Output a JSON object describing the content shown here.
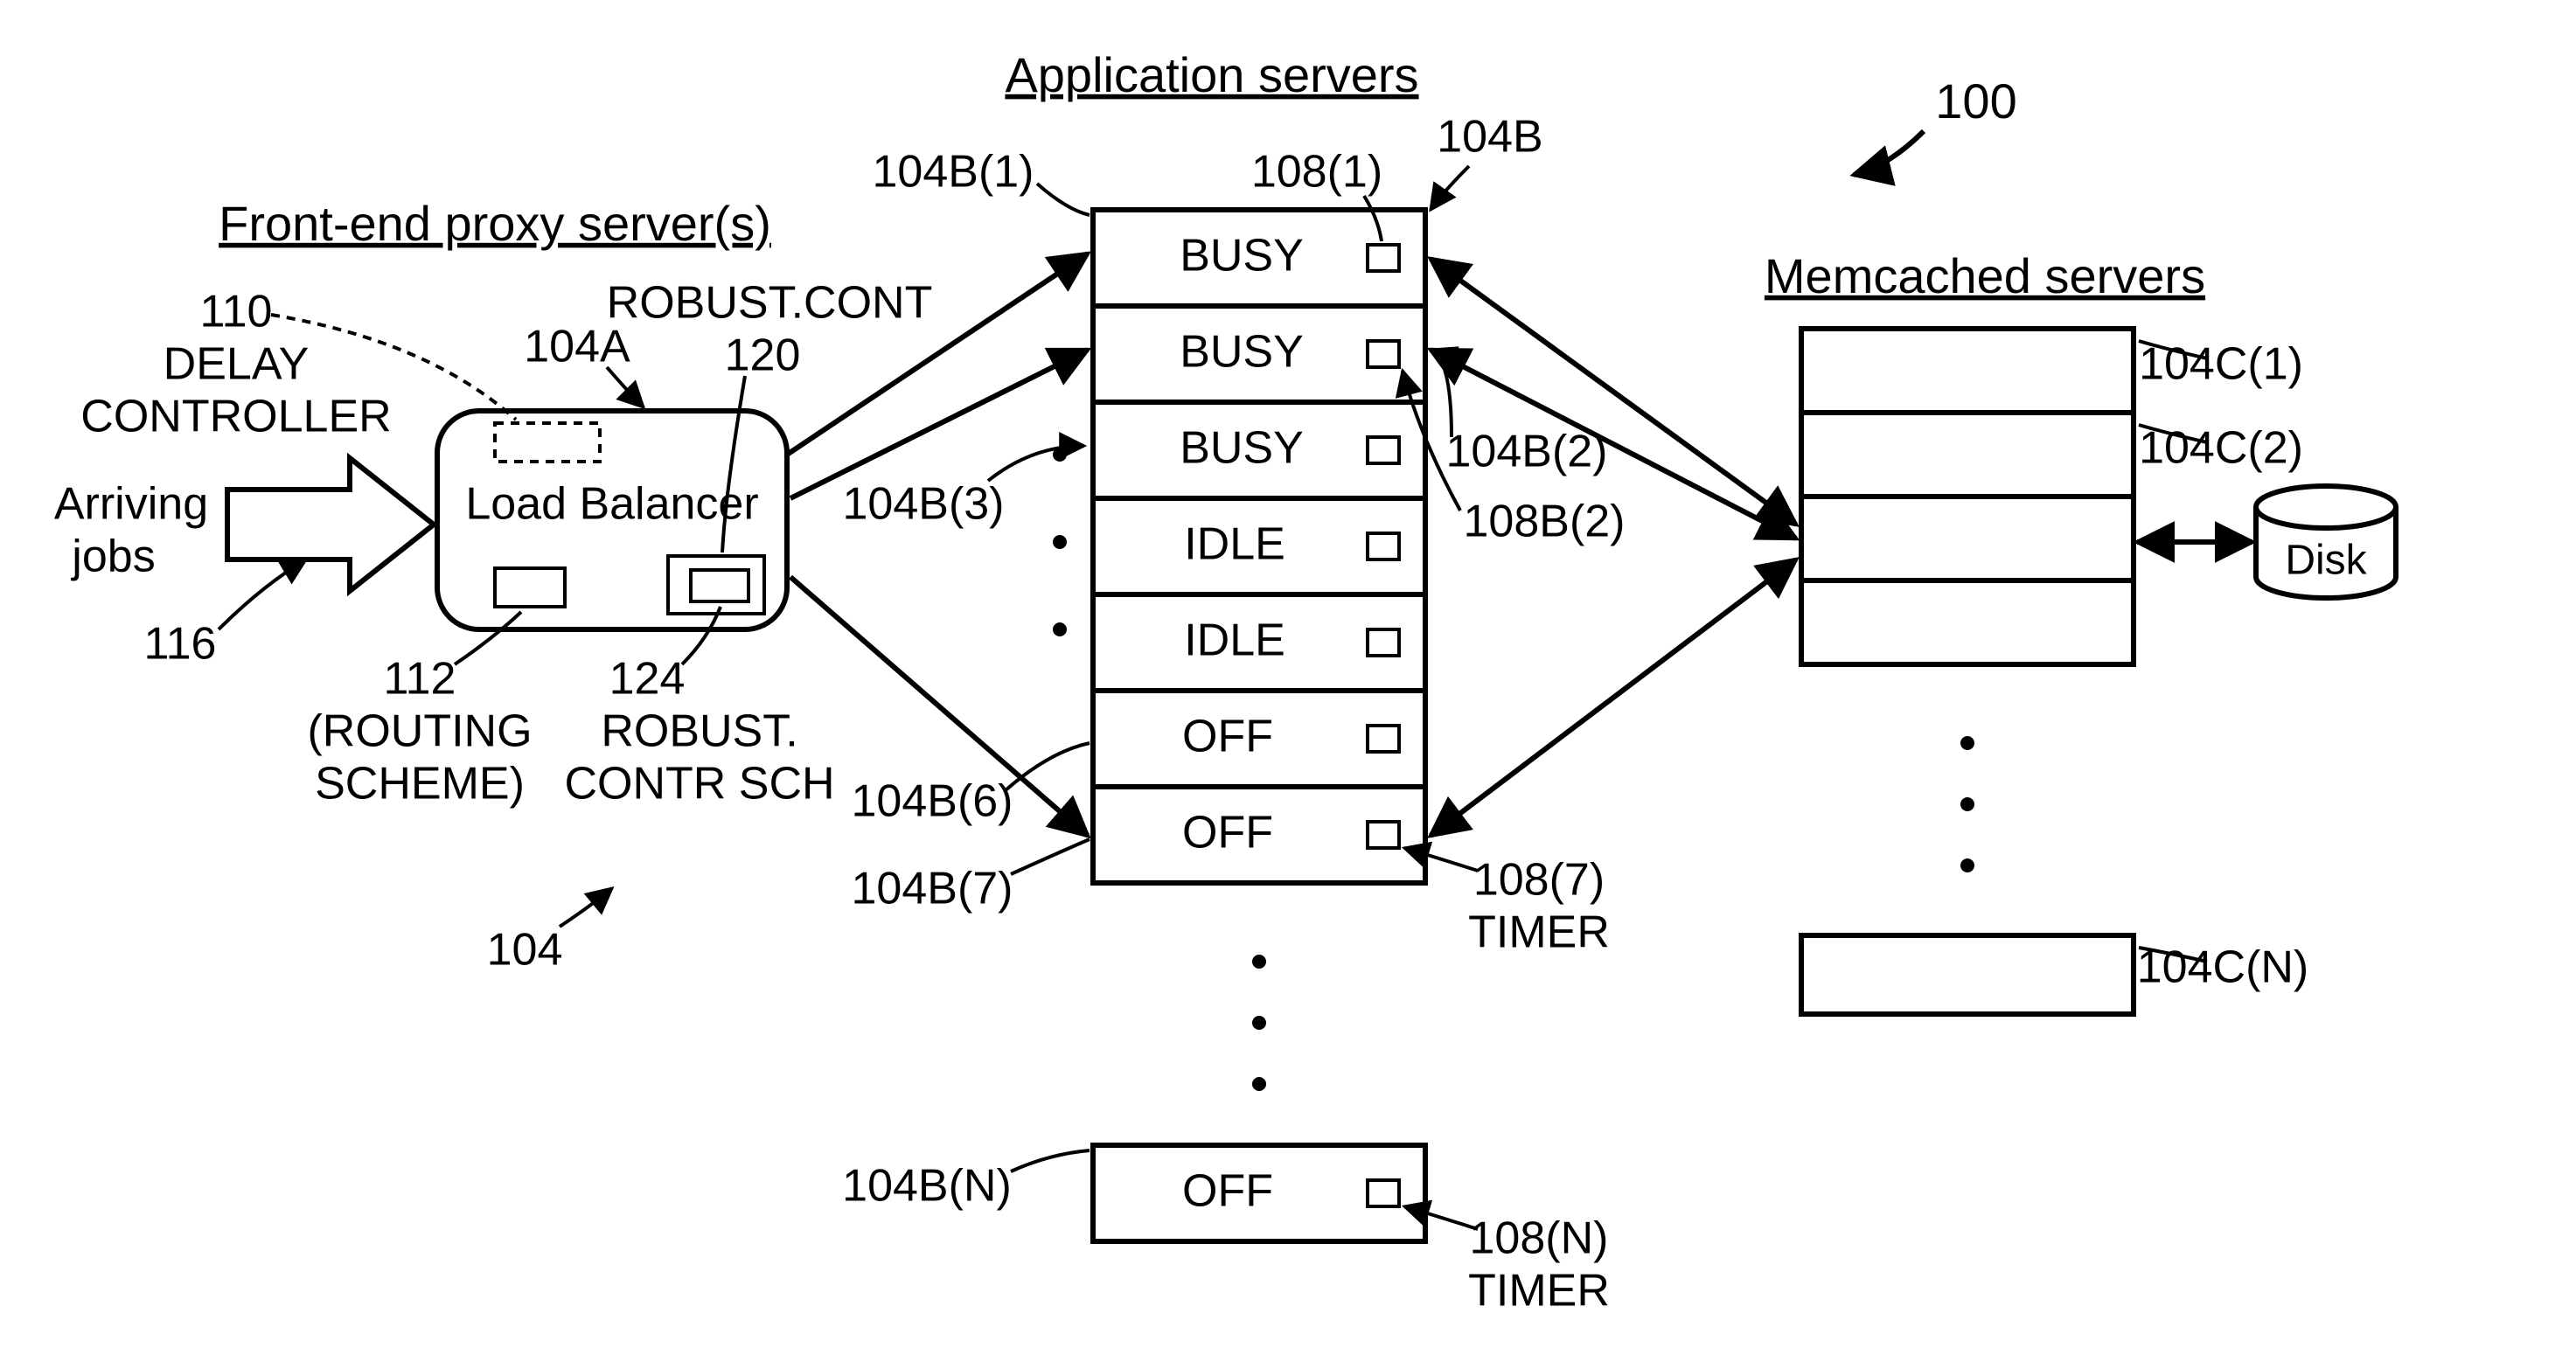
{
  "refnum_100": "100",
  "heading_front_end": "Front-end proxy server(s)",
  "heading_app_servers": "Application servers",
  "heading_memcached": "Memcached servers",
  "label_110_num": "110",
  "label_110_line1": "DELAY",
  "label_110_line2": "CONTROLLER",
  "label_104A": "104A",
  "label_robust_cont": "ROBUST.CONT",
  "label_120": "120",
  "label_arriving_line1": "Arriving",
  "label_arriving_line2": "jobs",
  "label_116": "116",
  "load_balancer_text": "Load Balancer",
  "label_112_num": "112",
  "label_112_line1": "(ROUTING",
  "label_112_line2": "SCHEME)",
  "label_124_num": "124",
  "label_124_line1": "ROBUST.",
  "label_124_line2": "CONTR SCH",
  "label_104": "104",
  "label_104B": "104B",
  "label_104B_1": "104B(1)",
  "label_104B_2": "104B(2)",
  "label_104B_3": "104B(3)",
  "label_104B_6": "104B(6)",
  "label_104B_7": "104B(7)",
  "label_104B_N": "104B(N)",
  "label_108_1": "108(1)",
  "label_108B_2": "108B(2)",
  "label_108_7_line1": "108(7)",
  "label_108_7_line2": "TIMER",
  "label_108_N_line1": "108(N)",
  "label_108_N_line2": "TIMER",
  "app_states": [
    "BUSY",
    "BUSY",
    "BUSY",
    "IDLE",
    "IDLE",
    "OFF",
    "OFF"
  ],
  "app_state_N": "OFF",
  "label_104C_1": "104C(1)",
  "label_104C_2": "104C(2)",
  "label_104C_N": "104C(N)",
  "disk_label": "Disk"
}
